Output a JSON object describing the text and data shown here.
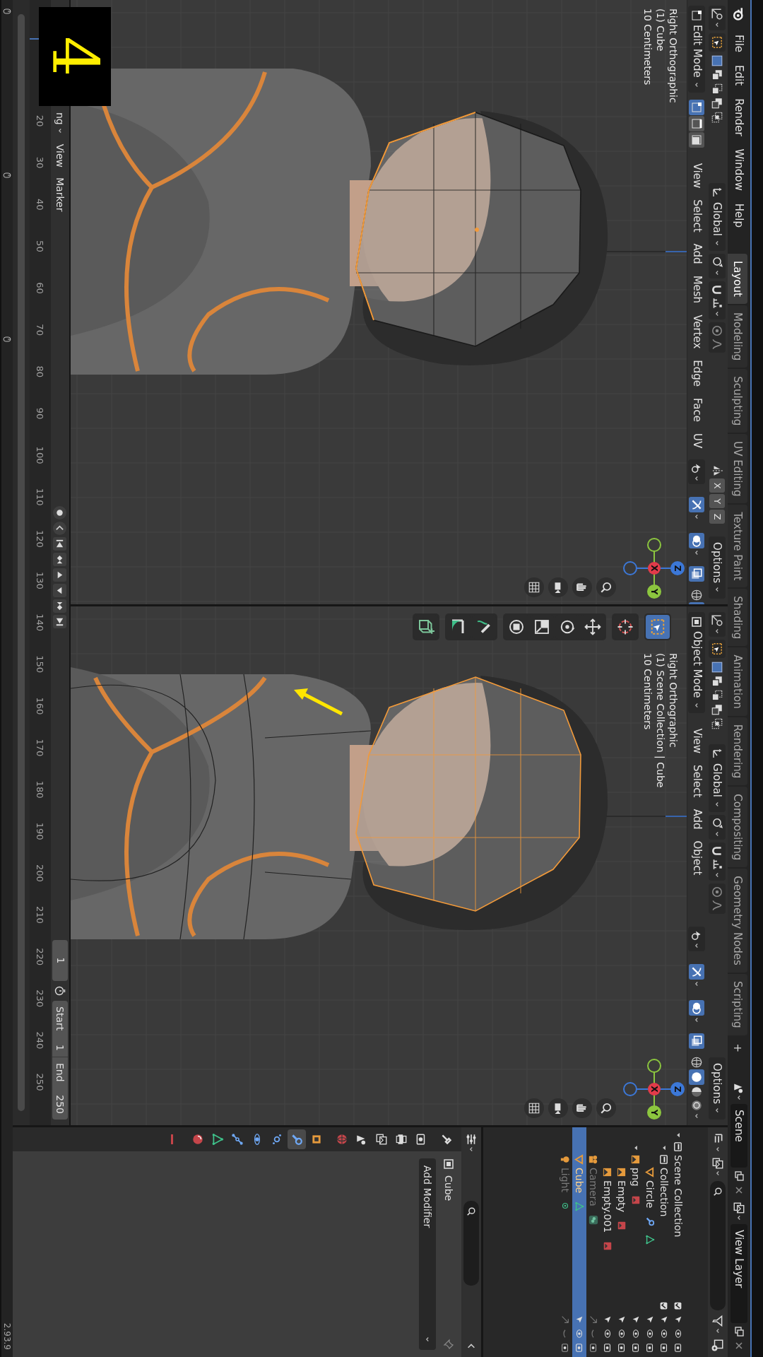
{
  "topbar": {
    "menus": [
      "File",
      "Edit",
      "Render",
      "Window",
      "Help"
    ],
    "workspaces": [
      {
        "label": "Layout",
        "selected": true
      },
      {
        "label": "Modeling",
        "selected": false
      },
      {
        "label": "Sculpting",
        "selected": false
      },
      {
        "label": "UV Editing",
        "selected": false
      },
      {
        "label": "Texture Paint",
        "selected": false
      },
      {
        "label": "Shading",
        "selected": false
      },
      {
        "label": "Animation",
        "selected": false
      },
      {
        "label": "Rendering",
        "selected": false
      },
      {
        "label": "Compositing",
        "selected": false
      },
      {
        "label": "Geometry Nodes",
        "selected": false
      },
      {
        "label": "Scripting",
        "selected": false
      }
    ],
    "add_workspace": "+",
    "scene": "Scene",
    "view_layer": "View Layer"
  },
  "viewports": [
    {
      "kind": "edit",
      "mode": "Edit Mode",
      "orientation": "Global",
      "mirror_axes": [
        "X",
        "Y",
        "Z"
      ],
      "options": "Options",
      "menus": [
        "View",
        "Select",
        "Add",
        "Mesh",
        "Vertex",
        "Edge",
        "Face",
        "UV"
      ],
      "select_modes": [
        {
          "kind": "vertex",
          "selected": true
        },
        {
          "kind": "edge",
          "selected": false
        },
        {
          "kind": "face",
          "selected": false
        }
      ],
      "info": [
        "Right Orthographic",
        "(1) Cube",
        "10 Centimeters"
      ],
      "gizmo": [
        "X",
        "Y",
        "Z"
      ]
    },
    {
      "kind": "object",
      "mode": "Object Mode",
      "orientation": "Global",
      "options": "Options",
      "menus": [
        "View",
        "Select",
        "Add",
        "Object"
      ],
      "info": [
        "Right Orthographic",
        "(1) Scene Collection | Cube",
        "10 Centimeters"
      ],
      "gizmo": [
        "X",
        "Y",
        "Z"
      ],
      "tool_groups": [
        [
          {
            "kind": "select_box",
            "selected": true
          }
        ],
        [
          {
            "kind": "cursor",
            "selected": false
          }
        ],
        [
          {
            "kind": "move",
            "selected": false
          },
          {
            "kind": "rotate",
            "selected": false
          },
          {
            "kind": "scale",
            "selected": false
          },
          {
            "kind": "transform",
            "selected": false
          }
        ],
        [
          {
            "kind": "annotate",
            "selected": false
          },
          {
            "kind": "measure",
            "selected": false
          }
        ],
        [
          {
            "kind": "add_cube",
            "selected": false
          }
        ]
      ]
    }
  ],
  "timeline": {
    "menus": [
      "ng",
      "View",
      "Marker"
    ],
    "ticks": [
      "20",
      "30",
      "40",
      "50",
      "60",
      "70",
      "80",
      "90",
      "100",
      "110",
      "120",
      "130",
      "140",
      "150",
      "160",
      "170",
      "180",
      "190",
      "200",
      "210",
      "220",
      "230",
      "240",
      "250"
    ],
    "current_frame": "1",
    "start_label": "Start",
    "start": "1",
    "end_label": "End",
    "end": "250"
  },
  "outliner": {
    "tree": [
      {
        "label": "Scene Collection",
        "kind": "scene_collection",
        "hidden": false,
        "selected": false,
        "children": [
          {
            "label": "Collection",
            "kind": "collection",
            "hidden": false,
            "selected": false,
            "expanded": true,
            "children": [
              {
                "label": "Circle",
                "kind": "mesh",
                "hidden": false,
                "selected": false,
                "modifiers": true
              }
            ]
          },
          {
            "label": "png",
            "kind": "empty_image",
            "hidden": false,
            "selected": false,
            "expanded": true,
            "children": [
              {
                "label": "Empty",
                "kind": "empty_image",
                "hidden": false,
                "selected": false
              },
              {
                "label": "Empty.001",
                "kind": "empty_image",
                "hidden": false,
                "selected": false
              }
            ]
          },
          {
            "label": "Camera",
            "kind": "camera",
            "hidden": true,
            "selected": false
          },
          {
            "label": "Cube",
            "kind": "mesh",
            "hidden": false,
            "selected": true,
            "modifiers": false
          },
          {
            "label": "Light",
            "kind": "light",
            "hidden": true,
            "selected": false
          }
        ]
      }
    ]
  },
  "properties": {
    "tab_groups": [
      [
        {
          "kind": "tool",
          "selected": false
        }
      ],
      [
        {
          "kind": "render",
          "selected": false
        },
        {
          "kind": "output",
          "selected": false
        },
        {
          "kind": "view_layer",
          "selected": false
        },
        {
          "kind": "scene",
          "selected": false
        },
        {
          "kind": "world",
          "selected": false
        }
      ],
      [
        {
          "kind": "object",
          "selected": false
        },
        {
          "kind": "modifiers",
          "selected": true
        },
        {
          "kind": "particles",
          "selected": false
        },
        {
          "kind": "physics",
          "selected": false
        },
        {
          "kind": "constraints",
          "selected": false
        },
        {
          "kind": "data",
          "selected": false
        },
        {
          "kind": "material",
          "selected": false
        }
      ],
      [
        {
          "kind": "texture",
          "selected": false
        }
      ]
    ],
    "object": "Cube",
    "add_modifier": "Add Modifier"
  },
  "status_bar": {
    "version": "2.93.9"
  },
  "step_badge": "4"
}
